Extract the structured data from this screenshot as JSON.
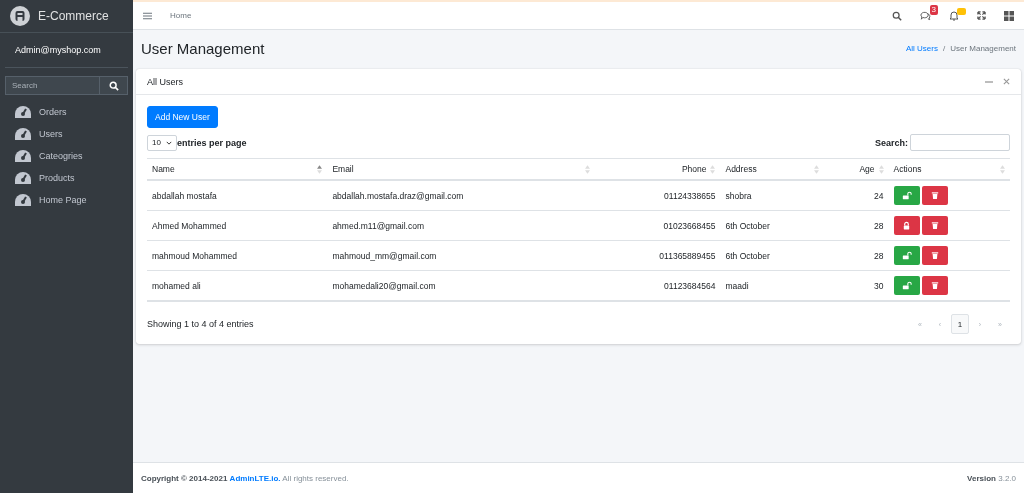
{
  "brand": {
    "title": "E-Commerce"
  },
  "sidebar": {
    "user": "Admin@myshop.com",
    "search": {
      "placeholder": "Search"
    },
    "items": [
      {
        "label": "Orders"
      },
      {
        "label": "Users"
      },
      {
        "label": "Cateogries"
      },
      {
        "label": "Products"
      },
      {
        "label": "Home Page"
      }
    ]
  },
  "navbar": {
    "links": [
      {
        "label": "Home"
      }
    ],
    "message_badge": "3"
  },
  "page": {
    "title": "User Management",
    "breadcrumb": [
      {
        "label": "All Users",
        "active": false
      },
      {
        "label": "User Management",
        "active": true
      }
    ],
    "breadcrumb_separator": "/"
  },
  "card": {
    "title": "All Users",
    "add_button": "Add New User",
    "page_size": "10",
    "page_size_label": "entries per page",
    "search_label": "Search:",
    "columns": [
      {
        "label": "Name",
        "sorted": true
      },
      {
        "label": "Email",
        "sorted": false
      },
      {
        "label": "Phone",
        "sorted": false
      },
      {
        "label": "Address",
        "sorted": false
      },
      {
        "label": "Age",
        "sorted": false
      },
      {
        "label": "Actions",
        "sorted": false
      }
    ],
    "rows": [
      {
        "cells": [
          "abdallah mostafa",
          "abdallah.mostafa.draz@gmail.com",
          "01124338655",
          "shobra",
          "24"
        ],
        "locked": false
      },
      {
        "cells": [
          "Ahmed Mohammed",
          "ahmed.m11@gmail.com",
          "01023668455",
          "6th October",
          "28"
        ],
        "locked": true
      },
      {
        "cells": [
          "mahmoud Mohammed",
          "mahmoud_mm@gmail.com",
          "011365889455",
          "6th October",
          "28"
        ],
        "locked": false
      },
      {
        "cells": [
          "mohamed ali",
          "mohamedali20@gmail.com",
          "01123684564",
          "maadi",
          "30"
        ],
        "locked": false
      }
    ],
    "info": "Showing 1 to 4 of 4 entries",
    "pagination": [
      {
        "label": "«",
        "selected": false
      },
      {
        "label": "‹",
        "selected": false
      },
      {
        "label": "1",
        "selected": true
      },
      {
        "label": "›",
        "selected": false
      },
      {
        "label": "»",
        "selected": false
      }
    ]
  },
  "footer": {
    "copyright": "**Copyright © 2014-2021** **AdminLTE.io.** All rights reserved.",
    "version_label": "Version",
    "version": "3.2.0"
  }
}
